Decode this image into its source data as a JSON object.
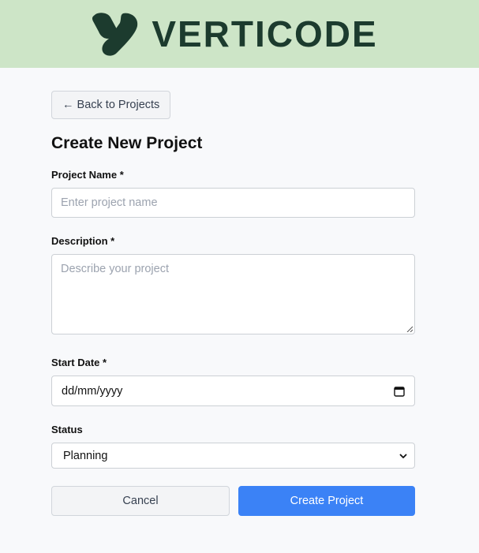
{
  "header": {
    "brand_name": "VERTICODE",
    "logo_icon": "verticode-logo-icon",
    "background": "#cde5c7",
    "brand_color": "#1c3b2e"
  },
  "nav": {
    "back_label": "← Back to Projects"
  },
  "form": {
    "title": "Create New Project",
    "project_name": {
      "label": "Project Name *",
      "placeholder": "Enter project name",
      "value": ""
    },
    "description": {
      "label": "Description *",
      "placeholder": "Describe your project",
      "value": ""
    },
    "start_date": {
      "label": "Start Date *",
      "value": "dd/mm/yyyy",
      "icon": "calendar-icon"
    },
    "status": {
      "label": "Status",
      "selected": "Planning",
      "icon": "chevron-down-icon"
    },
    "actions": {
      "cancel_label": "Cancel",
      "create_label": "Create Project",
      "accent": "#3b82f6"
    }
  }
}
